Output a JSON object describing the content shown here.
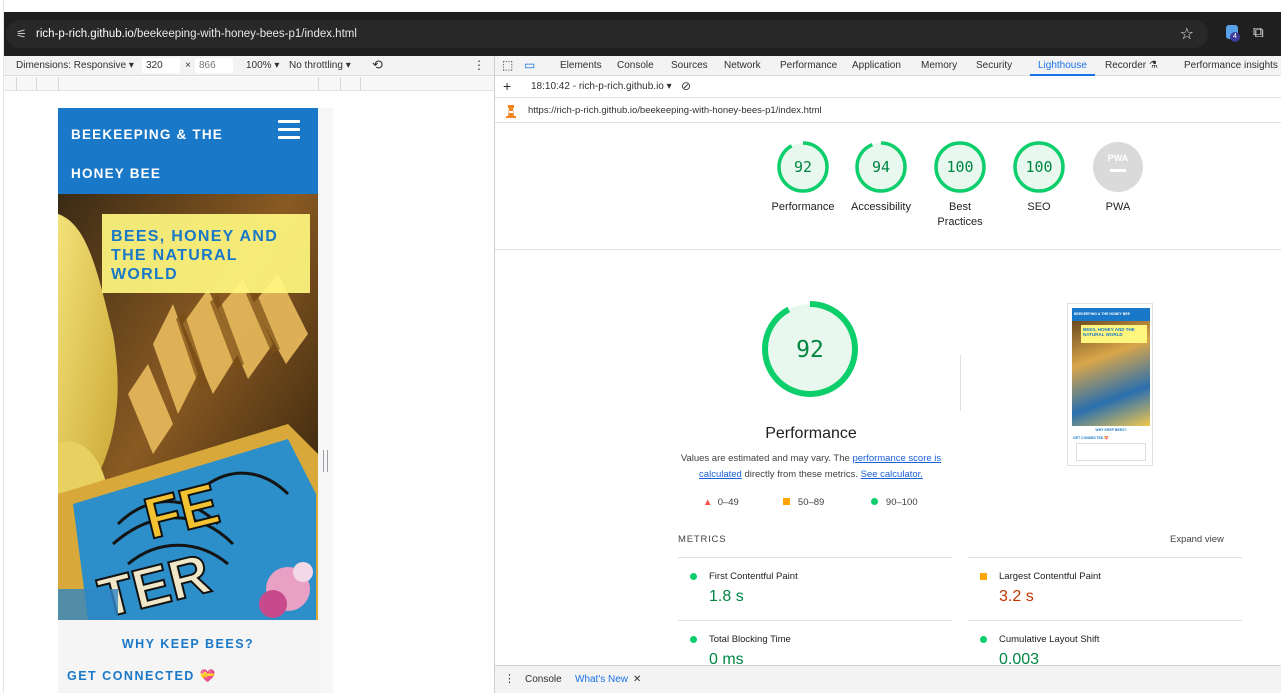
{
  "browser": {
    "url_host": "rich-p-rich.github.io",
    "url_path": "/beekeeping-with-honey-bees-p1/index.html",
    "extension_badge": "4"
  },
  "device_toolbar": {
    "dimensions": "Dimensions: Responsive ▾",
    "width": "320",
    "times": "×",
    "height": "866",
    "zoom": "100% ▾",
    "throttle": "No throttling ▾"
  },
  "site": {
    "title_line1": "BEEKEEPING & THE",
    "title_line2": "HONEY BEE",
    "hero_caption": [
      "BEES, HONEY AND",
      "THE NATURAL",
      "WORLD"
    ],
    "why_keep": "WHY KEEP BEES?",
    "get_connected": "GET CONNECTED 💝"
  },
  "devtools": {
    "tabs": [
      "Elements",
      "Console",
      "Sources",
      "Network",
      "Performance",
      "Application",
      "Memory",
      "Security",
      "Lighthouse",
      "Recorder ⚗",
      "Performance insights ⚗"
    ],
    "active_tab": "Lighthouse",
    "report_time": "18:10:42 - rich-p-rich.github.io ▾",
    "report_url": "https://rich-p-rich.github.io/beekeeping-with-honey-bees-p1/index.html",
    "gauges": [
      {
        "score": "92",
        "label": "Performance"
      },
      {
        "score": "94",
        "label": "Accessibility"
      },
      {
        "score": "100",
        "label": "Best Practices"
      },
      {
        "score": "100",
        "label": "SEO"
      },
      {
        "score": "PWA",
        "label": "PWA"
      }
    ],
    "performance": {
      "score": "92",
      "title": "Performance",
      "note_pre": "Values are estimated and may vary. The ",
      "note_link1": "performance score is calculated",
      "note_mid": " directly from these metrics. ",
      "note_link2": "See calculator.",
      "legend": [
        "0–49",
        "50–89",
        "90–100"
      ]
    },
    "metrics_title": "METRICS",
    "expand_view": "Expand view",
    "metrics": [
      {
        "name": "First Contentful Paint",
        "value": "1.8 s",
        "status": "good"
      },
      {
        "name": "Largest Contentful Paint",
        "value": "3.2 s",
        "status": "average"
      },
      {
        "name": "Total Blocking Time",
        "value": "0 ms",
        "status": "good"
      },
      {
        "name": "Cumulative Layout Shift",
        "value": "0.003",
        "status": "good"
      }
    ],
    "thumb": {
      "head": "BEEKEEPING & THE HONEY BEE",
      "caption": "BEES, HONEY AND THE NATURAL WORLD",
      "why": "WHY KEEP BEES?",
      "gc": "GET CONNECTED 💝"
    },
    "drawer": {
      "console": "Console",
      "whats_new": "What's New",
      "close": "✕"
    }
  },
  "colors": {
    "good": "#0cce6b",
    "average": "#ffa400",
    "poor": "#ff4e42",
    "good_text": "#018642",
    "average_text": "#c33300",
    "brand": "#1a78c8"
  }
}
